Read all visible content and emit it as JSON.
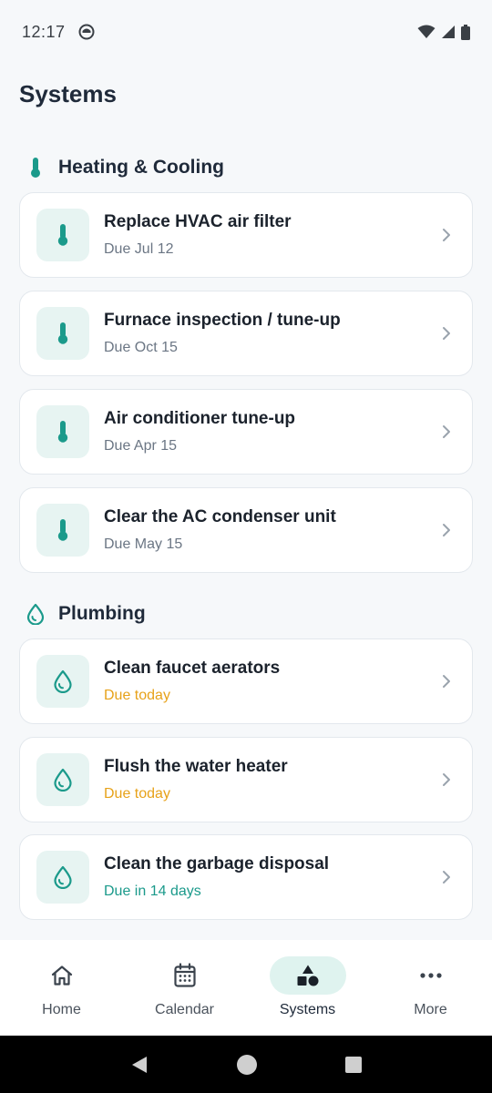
{
  "status_bar": {
    "time": "12:17"
  },
  "page": {
    "title": "Systems"
  },
  "sections": [
    {
      "title": "Heating & Cooling",
      "icon": "thermometer-icon",
      "items": [
        {
          "title": "Replace HVAC air filter",
          "due": "Due Jul 12",
          "due_status": "neutral"
        },
        {
          "title": "Furnace inspection / tune-up",
          "due": "Due Oct 15",
          "due_status": "neutral"
        },
        {
          "title": "Air conditioner tune-up",
          "due": "Due Apr 15",
          "due_status": "neutral"
        },
        {
          "title": "Clear the AC condenser unit",
          "due": "Due May 15",
          "due_status": "neutral"
        }
      ]
    },
    {
      "title": "Plumbing",
      "icon": "water-drop-icon",
      "items": [
        {
          "title": "Clean faucet aerators",
          "due": "Due today",
          "due_status": "warning"
        },
        {
          "title": "Flush the water heater",
          "due": "Due today",
          "due_status": "warning"
        },
        {
          "title": "Clean the garbage disposal",
          "due": "Due in 14 days",
          "due_status": "good"
        }
      ]
    }
  ],
  "bottom_nav": [
    {
      "label": "Home",
      "icon": "home-icon",
      "active": false
    },
    {
      "label": "Calendar",
      "icon": "calendar-icon",
      "active": false
    },
    {
      "label": "Systems",
      "icon": "shapes-icon",
      "active": true
    },
    {
      "label": "More",
      "icon": "more-dots-icon",
      "active": false
    }
  ],
  "colors": {
    "accent": "#1b9a8b",
    "icon_bg": "#e7f4f2",
    "warning": "#e7a21a",
    "nav_active_bg": "#dff3ef"
  }
}
